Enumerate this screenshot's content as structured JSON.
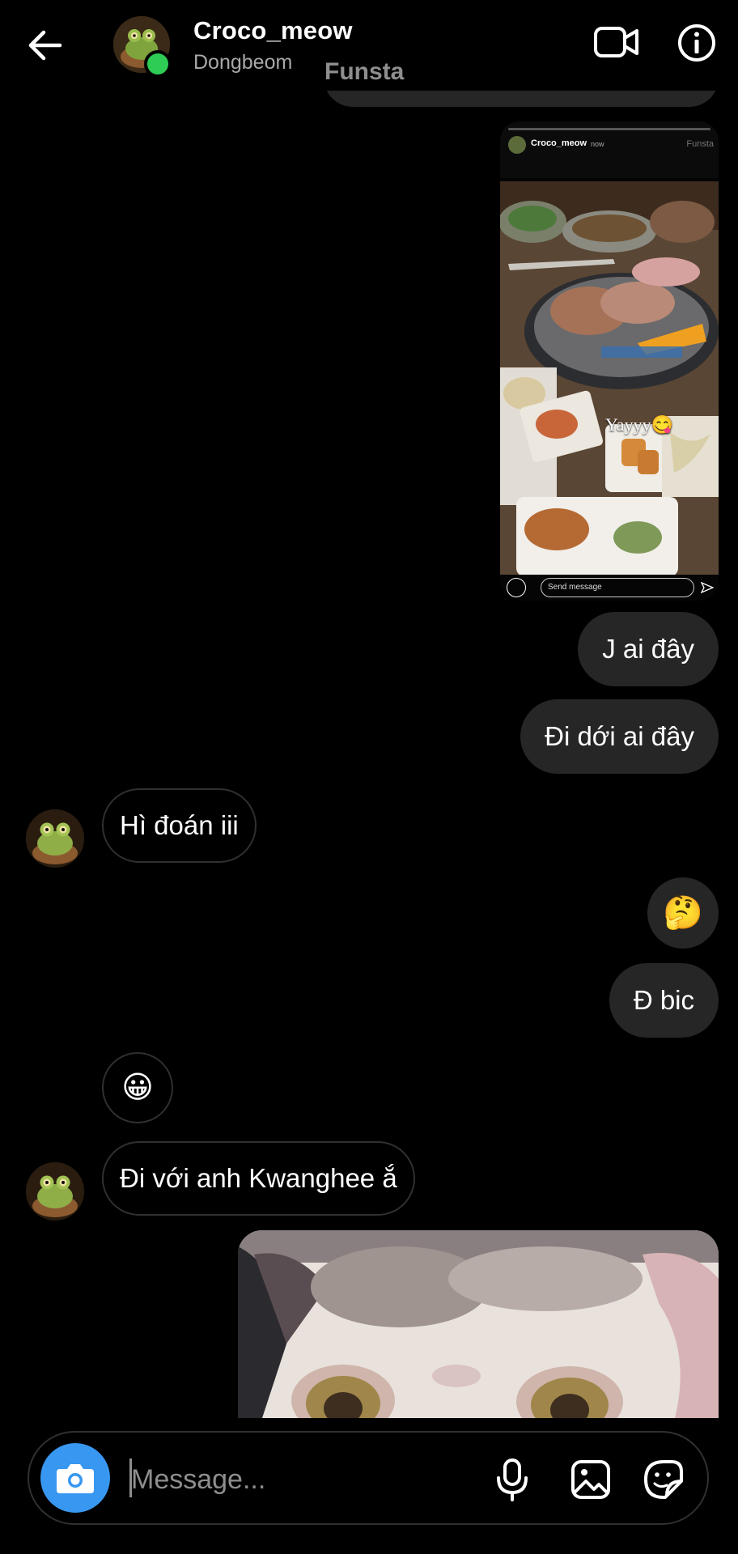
{
  "header": {
    "title": "Croco_meow",
    "subtitle": "Dongbeom",
    "overlay_tag": "Funsta",
    "online_color": "#2ecc55"
  },
  "icons": {
    "back": "back-arrow-icon",
    "video": "video-call-icon",
    "info": "info-icon",
    "camera": "camera-icon",
    "mic": "microphone-icon",
    "gallery": "gallery-icon",
    "sticker": "sticker-icon"
  },
  "story_share": {
    "username": "Croco_meow",
    "time": "now",
    "tag": "Funsta",
    "caption": "Yayyy😋",
    "reply_placeholder": "Send message"
  },
  "messages": [
    {
      "side": "out",
      "text": "J ai đây"
    },
    {
      "side": "out",
      "text": "Đi dới ai đây"
    },
    {
      "side": "in",
      "text": "Hì đoán iii"
    },
    {
      "side": "out",
      "text": "🤔"
    },
    {
      "side": "out",
      "text": "Đ bic"
    },
    {
      "side": "in",
      "text": "😀"
    },
    {
      "side": "in",
      "text": "Đi với anh Kwanghee ắ"
    }
  ],
  "composer": {
    "placeholder": "Message..."
  },
  "colors": {
    "background": "#000000",
    "outgoing_bubble": "#262626",
    "incoming_border": "#303030",
    "camera_button": "#3897f0"
  }
}
